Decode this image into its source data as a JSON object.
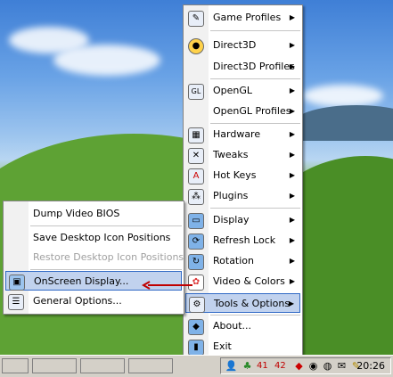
{
  "colors": {
    "menu_highlight": "#c1d2ee",
    "menu_border": "#316ac5",
    "disabled_text": "#a0a0a0",
    "tray_number": "#c00000",
    "arrow": "#c00000"
  },
  "main_menu": {
    "items": [
      {
        "label": "Game Profiles",
        "icon": "game-profiles-icon",
        "submenu": true
      },
      {
        "label": "Direct3D",
        "icon": "direct3d-icon",
        "submenu": true
      },
      {
        "label": "Direct3D Profiles",
        "icon": "",
        "submenu": true
      },
      {
        "label": "OpenGL",
        "icon": "opengl-icon",
        "submenu": true
      },
      {
        "label": "OpenGL Profiles",
        "icon": "",
        "submenu": true
      },
      {
        "label": "Hardware",
        "icon": "hardware-icon",
        "submenu": true
      },
      {
        "label": "Tweaks",
        "icon": "tweaks-icon",
        "submenu": true
      },
      {
        "label": "Hot Keys",
        "icon": "hot-keys-icon",
        "submenu": true
      },
      {
        "label": "Plugins",
        "icon": "plugins-icon",
        "submenu": true
      },
      {
        "label": "Display",
        "icon": "display-icon",
        "submenu": true
      },
      {
        "label": "Refresh Lock",
        "icon": "refresh-lock-icon",
        "submenu": true
      },
      {
        "label": "Rotation",
        "icon": "rotation-icon",
        "submenu": true
      },
      {
        "label": "Video & Colors",
        "icon": "video-colors-icon",
        "submenu": true
      },
      {
        "label": "Tools & Options",
        "icon": "tools-options-icon",
        "submenu": true
      },
      {
        "label": "About...",
        "icon": "about-icon",
        "submenu": false
      },
      {
        "label": "Exit",
        "icon": "exit-icon",
        "submenu": false
      }
    ]
  },
  "sub_menu": {
    "items": [
      {
        "label": "Dump Video BIOS",
        "enabled": true
      },
      {
        "label": "Save Desktop Icon Positions",
        "enabled": true
      },
      {
        "label": "Restore Desktop Icon Positions",
        "enabled": false
      },
      {
        "label": "OnScreen Display...",
        "enabled": true,
        "icon": "onscreen-display-icon"
      },
      {
        "label": "General Options...",
        "enabled": true,
        "icon": "general-options-icon"
      }
    ]
  },
  "tray": {
    "num1": "41",
    "num2": "42",
    "clock": "20:26"
  }
}
